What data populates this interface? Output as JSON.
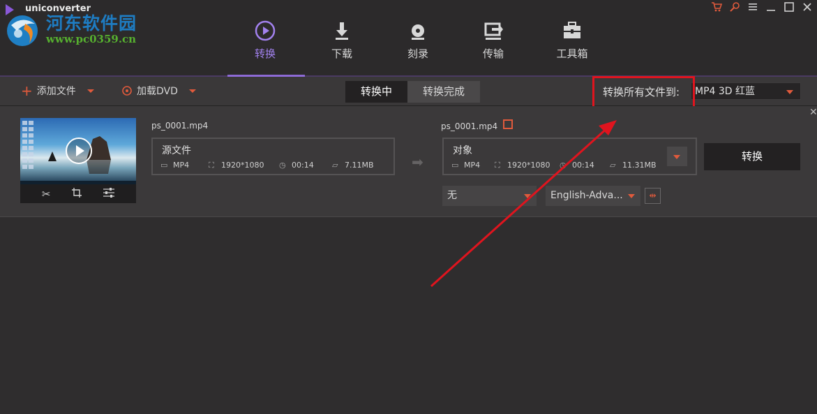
{
  "app": {
    "title": "uniconverter"
  },
  "watermark": {
    "site_name": "河东软件园",
    "url": "www.pc0359.cn"
  },
  "nav": {
    "items": [
      {
        "label": "转换",
        "icon": "convert-icon"
      },
      {
        "label": "下载",
        "icon": "download-icon"
      },
      {
        "label": "刻录",
        "icon": "burn-disc-icon"
      },
      {
        "label": "传输",
        "icon": "transfer-icon"
      },
      {
        "label": "工具箱",
        "icon": "toolbox-icon"
      }
    ],
    "active_index": 0
  },
  "window_controls": [
    "cart-icon",
    "search-icon",
    "menu-icon",
    "minimize-icon",
    "maximize-icon",
    "close-icon"
  ],
  "toolbar": {
    "add_file_label": "添加文件",
    "load_dvd_label": "加载DVD",
    "tab_converting": "转换中",
    "tab_finished": "转换完成",
    "convert_all_label": "转换所有文件到:",
    "convert_all_format": "MP4 3D 红蓝"
  },
  "file": {
    "source_name": "ps_0001.mp4",
    "source_label": "源文件",
    "source_format": "MP4",
    "source_resolution": "1920*1080",
    "source_duration": "00:14",
    "source_size": "7.11MB",
    "target_name": "ps_0001.mp4",
    "target_label": "对象",
    "target_format": "MP4",
    "target_resolution": "1920*1080",
    "target_duration": "00:14",
    "target_size": "11.31MB",
    "subtitle_value": "无",
    "audio_value": "English-Adva...",
    "convert_button": "转换"
  },
  "colors": {
    "accent_purple": "#a281ee",
    "accent_orange": "#e05a3c",
    "highlight_red": "#e0141e"
  }
}
